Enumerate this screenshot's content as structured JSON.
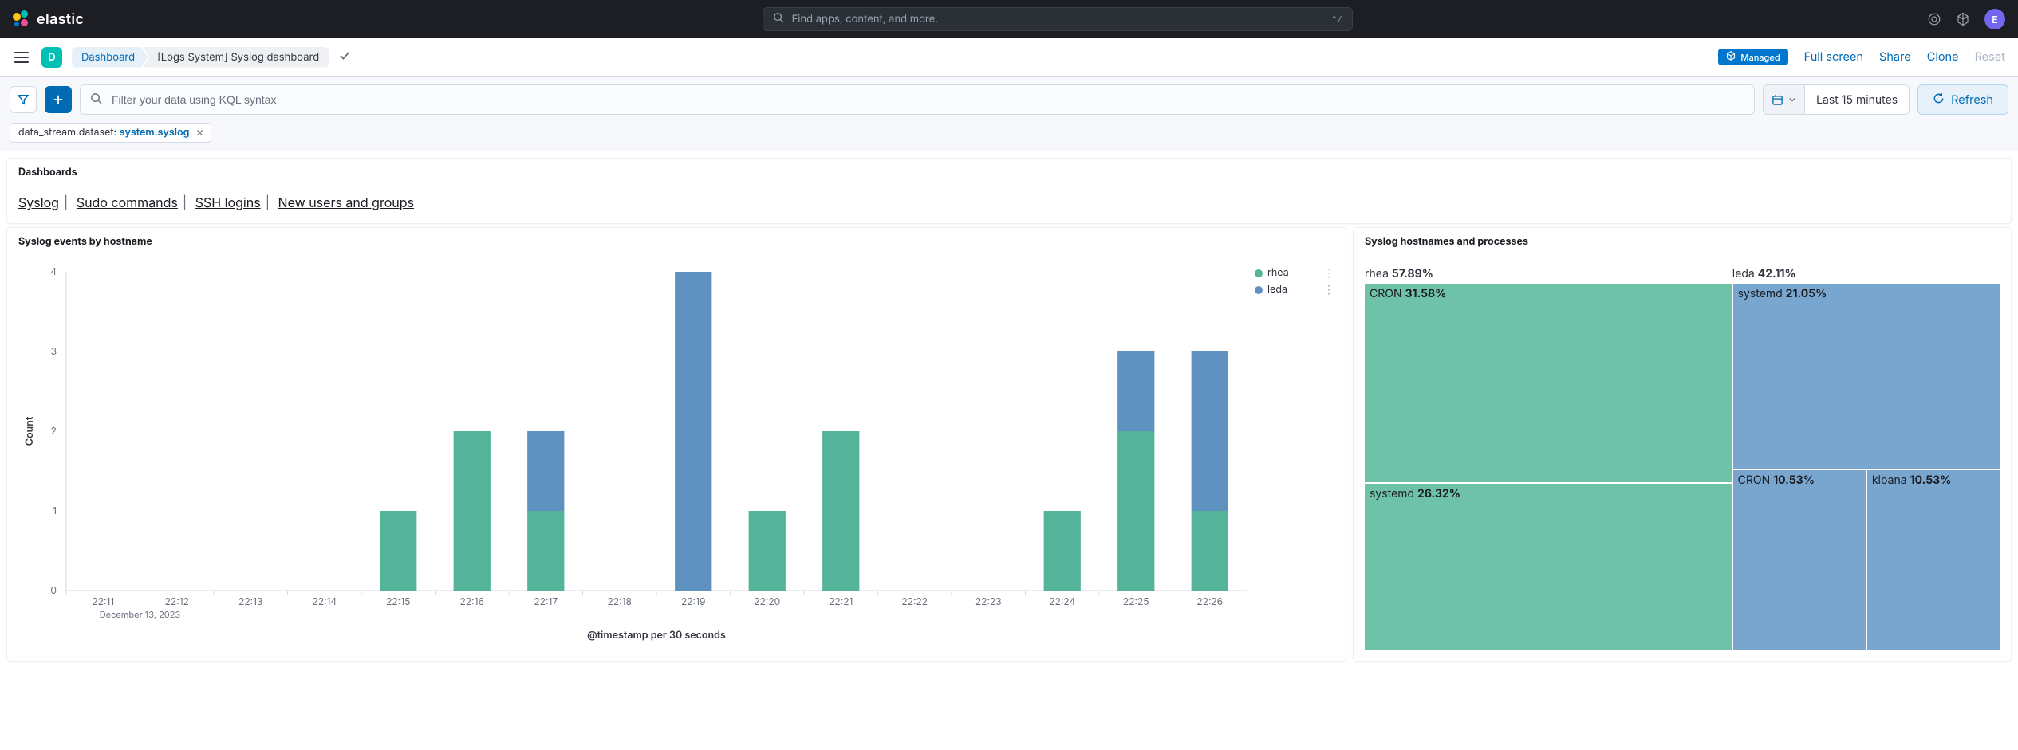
{
  "header": {
    "logo_text": "elastic",
    "search_placeholder": "Find apps, content, and more.",
    "kbd_hint": "^/",
    "avatar_letter": "E"
  },
  "subheader": {
    "app_letter": "D",
    "crumb1": "Dashboard",
    "crumb2": "[Logs System] Syslog dashboard",
    "managed_icon": "⎈",
    "managed_label": "Managed",
    "fullscreen": "Full screen",
    "share": "Share",
    "clone": "Clone",
    "reset": "Reset"
  },
  "querybar": {
    "placeholder": "Filter your data using KQL syntax",
    "time_label": "Last 15 minutes",
    "refresh": "Refresh"
  },
  "filter_pill": {
    "key": "data_stream.dataset: ",
    "value": "system.syslog"
  },
  "dash_links": {
    "title": "Dashboards",
    "l1": "Syslog",
    "l2": "Sudo commands",
    "l3": "SSH logins",
    "l4": "New users and groups"
  },
  "barpanel": {
    "title": "Syslog events by hostname",
    "ylabel": "Count",
    "xlabel": "@timestamp per 30 seconds",
    "date_sub": "December 13, 2023",
    "legend1": "rhea",
    "legend2": "leda"
  },
  "treepanel": {
    "title": "Syslog hostnames and processes",
    "h1_name": "rhea",
    "h1_pct": "57.89%",
    "h2_name": "leda",
    "h2_pct": "42.11%",
    "c11_name": "CRON",
    "c11_pct": "31.58%",
    "c12_name": "systemd",
    "c12_pct": "26.32%",
    "c21_name": "systemd",
    "c21_pct": "21.05%",
    "c22_name": "CRON",
    "c22_pct": "10.53%",
    "c23_name": "kibana",
    "c23_pct": "10.53%"
  },
  "chart_data": [
    {
      "type": "bar",
      "title": "Syslog events by hostname",
      "xlabel": "@timestamp per 30 seconds",
      "ylabel": "Count",
      "ylim": [
        0,
        4
      ],
      "x_date": "December 13, 2023",
      "categories": [
        "22:11",
        "22:12",
        "22:13",
        "22:14",
        "22:15",
        "22:16",
        "22:17",
        "22:18",
        "22:19",
        "22:20",
        "22:21",
        "22:22",
        "22:23",
        "22:24",
        "22:25",
        "22:26"
      ],
      "series": [
        {
          "name": "rhea",
          "color": "#54b399",
          "values": [
            0,
            0,
            0,
            0,
            1,
            2,
            1,
            0,
            0,
            1,
            2,
            0,
            0,
            1,
            2,
            1
          ]
        },
        {
          "name": "leda",
          "color": "#6092c0",
          "values": [
            0,
            0,
            0,
            0,
            0,
            0,
            1,
            0,
            4,
            0,
            0,
            0,
            0,
            0,
            1,
            2
          ]
        }
      ]
    },
    {
      "type": "treemap",
      "title": "Syslog hostnames and processes",
      "nodes": [
        {
          "name": "rhea",
          "pct": 57.89,
          "color": "#6dc2a8",
          "children": [
            {
              "name": "CRON",
              "pct": 31.58
            },
            {
              "name": "systemd",
              "pct": 26.32
            }
          ]
        },
        {
          "name": "leda",
          "pct": 42.11,
          "color": "#79a6cf",
          "children": [
            {
              "name": "systemd",
              "pct": 21.05
            },
            {
              "name": "CRON",
              "pct": 10.53
            },
            {
              "name": "kibana",
              "pct": 10.53
            }
          ]
        }
      ]
    }
  ],
  "colors": {
    "green": "#54b399",
    "green_light": "#6dc2a8",
    "blue": "#6092c0",
    "blue_light": "#79a6cf"
  }
}
